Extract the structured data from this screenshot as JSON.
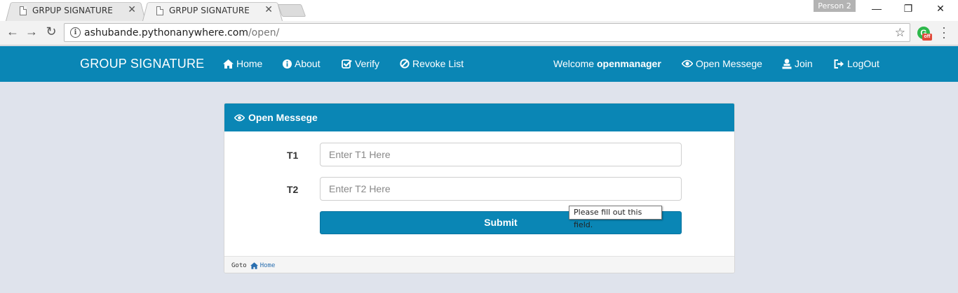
{
  "browser": {
    "tabs": [
      {
        "title": "GRPUP SIGNATURE",
        "active": false
      },
      {
        "title": "GRPUP SIGNATURE",
        "active": true
      }
    ],
    "profile": "Person 2",
    "address": {
      "host": "ashubande.pythonanywhere.com",
      "path": "/open/"
    },
    "extension_badge": "off"
  },
  "navbar": {
    "brand": "GROUP SIGNATURE",
    "links": [
      {
        "label": "Home",
        "icon": "home-icon"
      },
      {
        "label": "About",
        "icon": "info-icon"
      },
      {
        "label": "Verify",
        "icon": "check-square-icon"
      },
      {
        "label": "Revoke List",
        "icon": "ban-icon"
      }
    ],
    "welcome_prefix": "Welcome",
    "username": "openmanager",
    "right_links": [
      {
        "label": "Open Messege",
        "icon": "eye-icon"
      },
      {
        "label": "Join",
        "icon": "user-icon"
      },
      {
        "label": "LogOut",
        "icon": "logout-icon"
      }
    ]
  },
  "panel": {
    "title": "Open Messege",
    "fields": [
      {
        "label": "T1",
        "placeholder": "Enter T1 Here",
        "value": ""
      },
      {
        "label": "T2",
        "placeholder": "Enter T2 Here",
        "value": ""
      }
    ],
    "submit_label": "Submit",
    "validation_tooltip": "Please fill out this field.",
    "footer": {
      "goto_label": "Goto",
      "home_label": "Home"
    }
  },
  "colors": {
    "primary": "#0a86b5",
    "page_bg": "#dfe3ec"
  }
}
